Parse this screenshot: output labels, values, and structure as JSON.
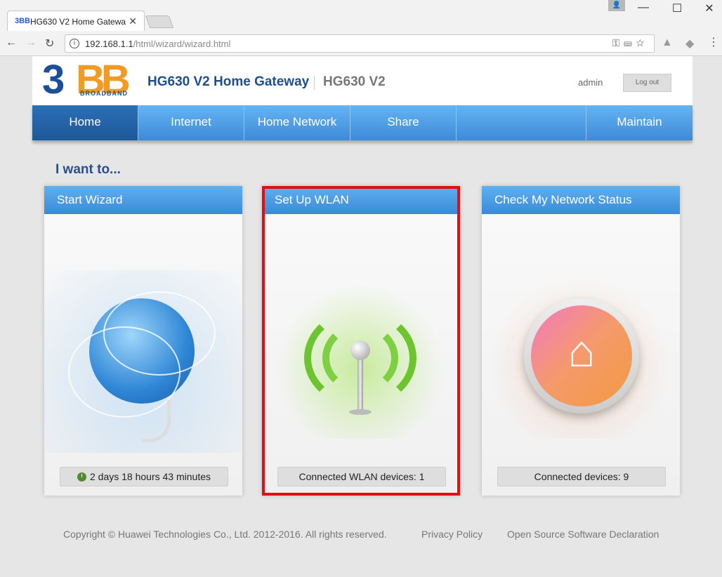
{
  "browser": {
    "tab_title": "HG630 V2 Home Gatewa",
    "tab_logo": "3BB",
    "url_host": "192.168.1.1",
    "url_path": "/html/wizard/wizard.html"
  },
  "header": {
    "product_title": "HG630 V2 Home Gateway",
    "product_model": "HG630 V2",
    "user": "admin",
    "logout_label": "Log out",
    "logo_text": "3BB",
    "logo_sub": "BROADBAND"
  },
  "menu": {
    "items": [
      {
        "label": "Home"
      },
      {
        "label": "Internet"
      },
      {
        "label": "Home Network"
      },
      {
        "label": "Share"
      },
      {
        "label": ""
      },
      {
        "label": "Maintain"
      }
    ],
    "active": "Home"
  },
  "main": {
    "heading": "I want to...",
    "cards": [
      {
        "title": "Start Wizard",
        "footer": "2 days 18 hours 43 minutes"
      },
      {
        "title": "Set Up WLAN",
        "footer": "Connected WLAN devices: 1"
      },
      {
        "title": "Check My Network Status",
        "footer": "Connected devices: 9"
      }
    ]
  },
  "footer": {
    "copyright": "Copyright © Huawei Technologies Co., Ltd. 2012-2016. All rights reserved.",
    "privacy": "Privacy Policy",
    "oss": "Open Source Software Declaration"
  },
  "colors": {
    "menu_blue": "#3d8ad8",
    "highlight_red": "#e20d15",
    "title_blue": "#1d4f8f"
  }
}
